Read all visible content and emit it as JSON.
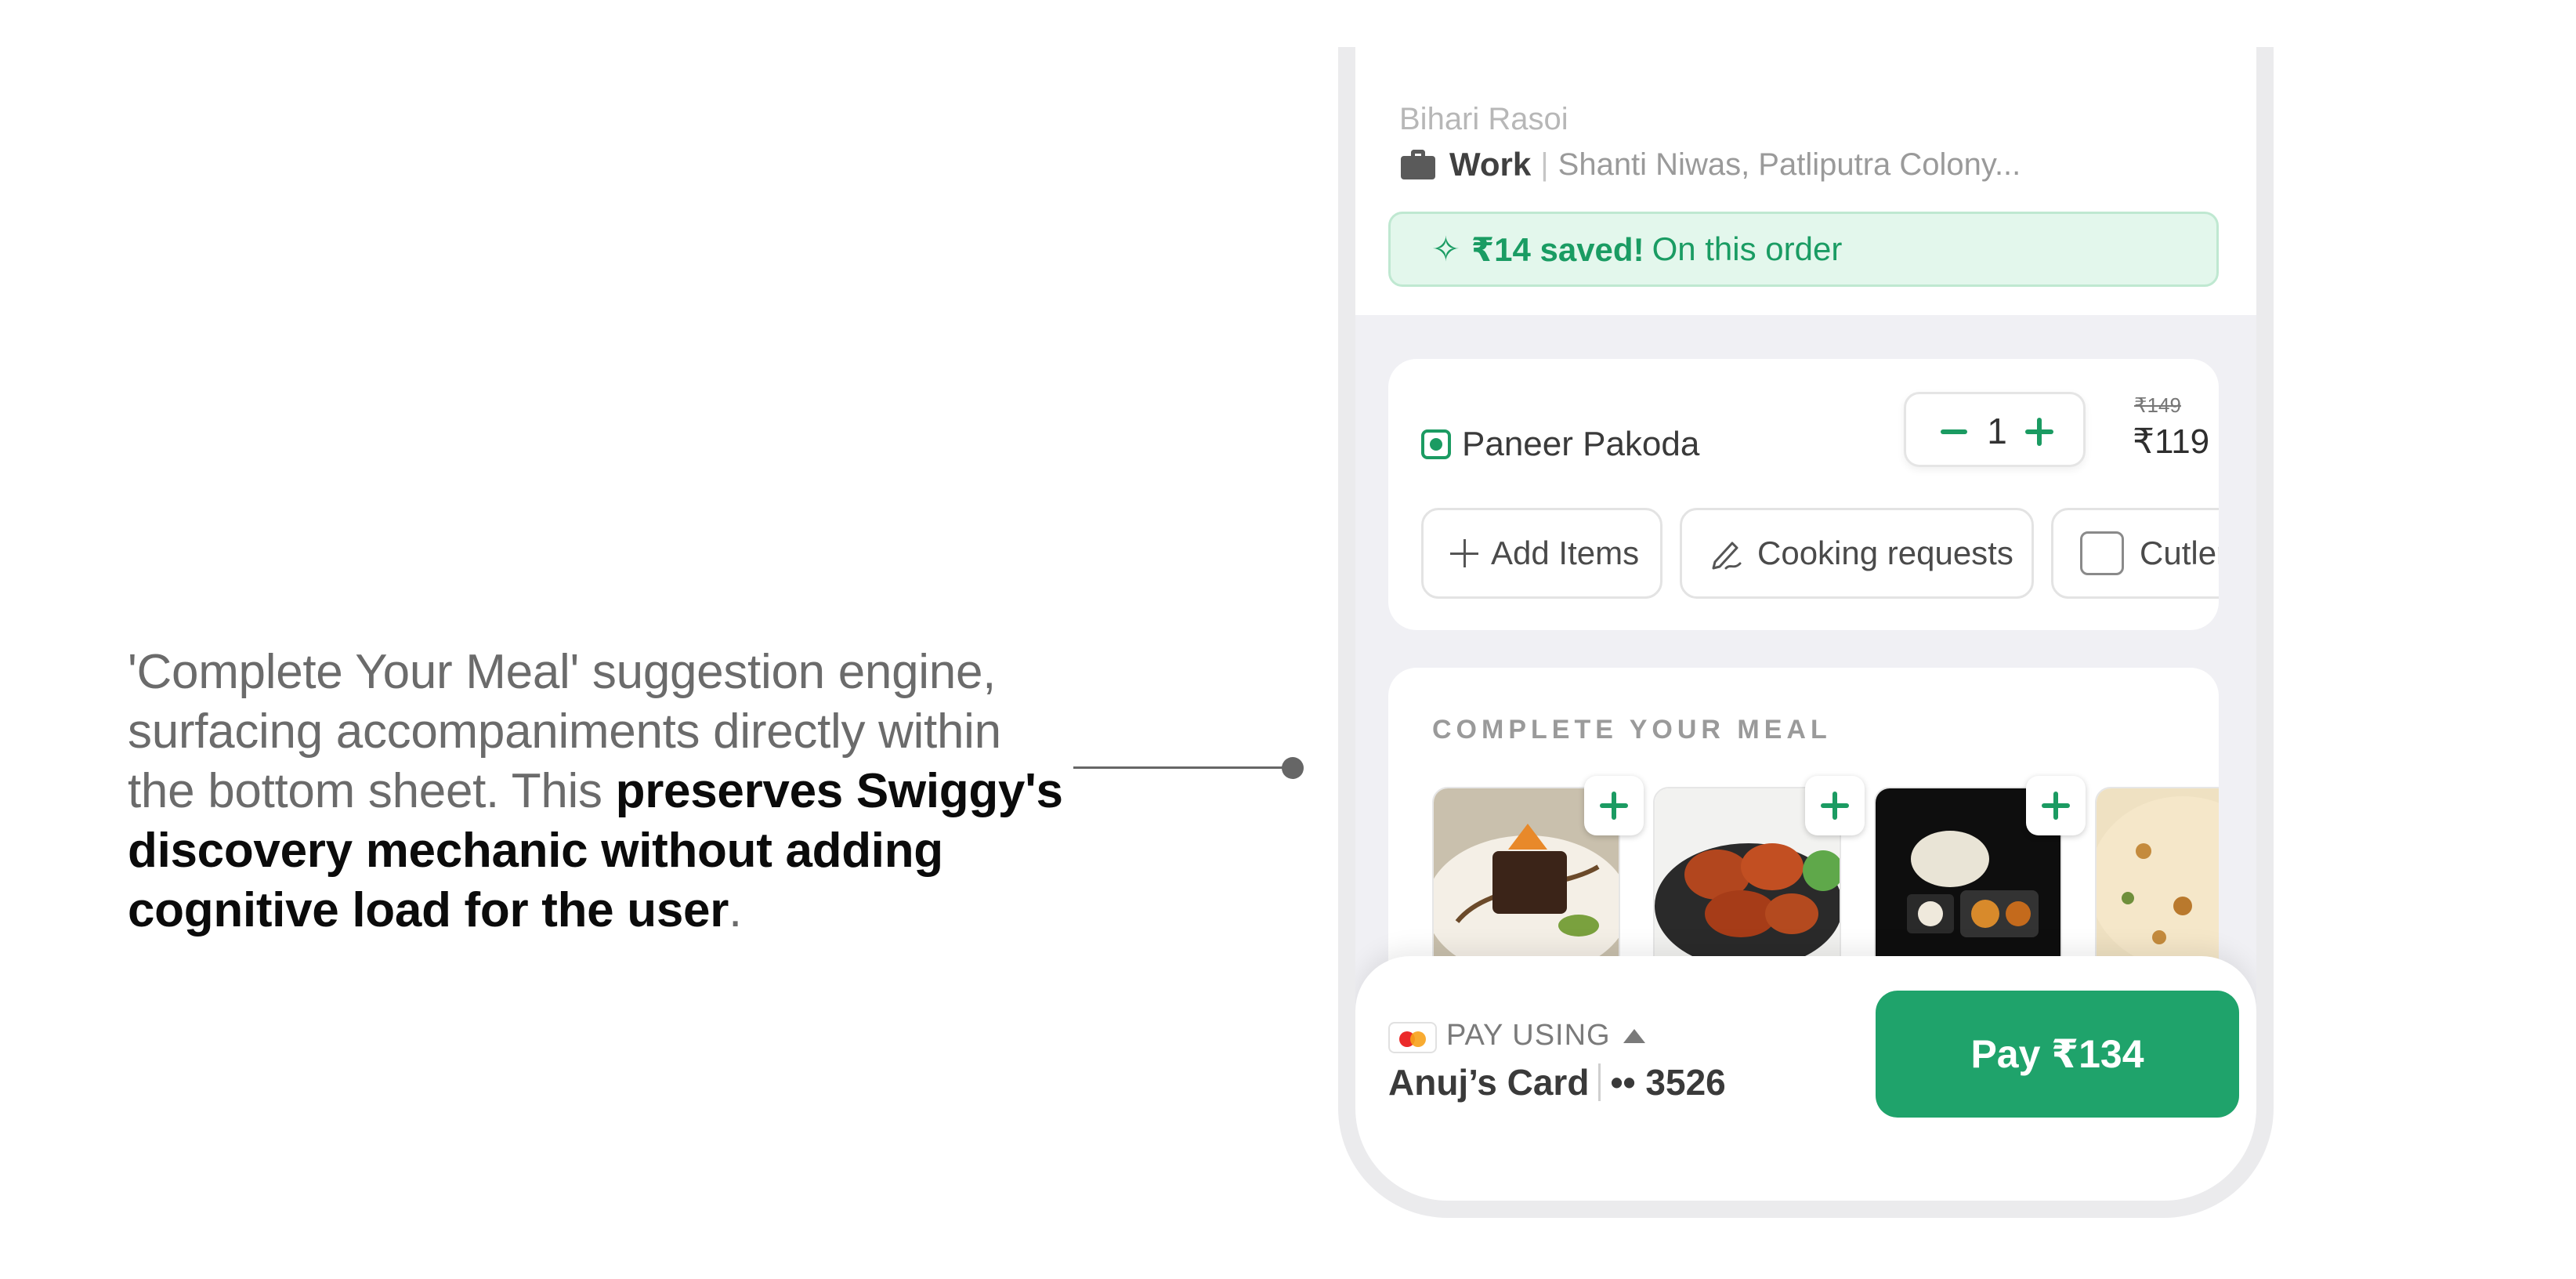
{
  "annotation": {
    "text_plain": "'Complete Your Meal' suggestion engine, surfacing accompaniments directly within the bottom sheet. This ",
    "text_bold": "preserves Swiggy's discovery mechanic without adding cognitive load for the user",
    "text_end": "."
  },
  "header": {
    "restaurant": "Bihari Rasoi",
    "address_type": "Work",
    "address_separator": "|",
    "address_text": "Shanti Niwas, Patliputra Colony...",
    "address_icon": "briefcase-icon"
  },
  "savings": {
    "icon": "sparkle-icon",
    "sparkle": "✧",
    "amount": "₹14 saved!",
    "text": "On this order"
  },
  "cart_item": {
    "name": "Paneer Pakoda",
    "quantity": "1",
    "price_original": "₹149",
    "price_final": "₹119"
  },
  "actions": {
    "add_items": "Add Items",
    "cooking_requests": "Cooking requests",
    "cutlery": "Cutlery"
  },
  "meal": {
    "title": "COMPLETE YOUR MEAL"
  },
  "payment": {
    "pay_using": "PAY USING",
    "card_name": "Anuj’s Card",
    "card_separator": "|",
    "card_number": "•• 3526",
    "pay_button": "Pay ₹134"
  },
  "colors": {
    "accent": "#1fa36b",
    "savings_bg": "#e3f7ec",
    "page_bg": "#f0f0f4"
  }
}
